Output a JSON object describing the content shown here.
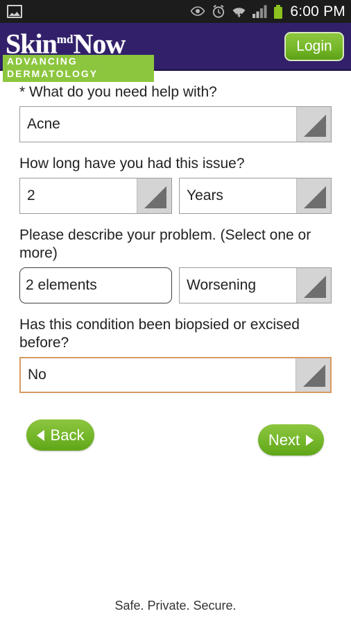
{
  "status_bar": {
    "notification_icon": "picture-icon",
    "icons": [
      "eye-icon",
      "alarm-clock-icon",
      "wifi-icon",
      "signal-bars-icon",
      "battery-icon"
    ],
    "time": "6:00 PM",
    "battery_color": "#8bc220"
  },
  "header": {
    "logo_main": "Skin",
    "logo_sup": "md",
    "logo_main2": "Now",
    "logo_tagline": "ADVANCING DERMATOLOGY",
    "login_label": "Login",
    "background_color": "#32206a",
    "accent_green": "#8cc63f"
  },
  "form": {
    "q1": {
      "label": "* What do you need help with?",
      "value": "Acne"
    },
    "q2": {
      "label": "How long have you had this issue?",
      "amount_value": "2",
      "unit_value": "Years"
    },
    "q3": {
      "label": "Please describe your problem. (Select one or more)",
      "multi_value": "2 elements",
      "trend_value": "Worsening"
    },
    "q4": {
      "label": "Has this condition been biopsied or excised before?",
      "value": "No",
      "focus_border_color": "#d89a62"
    }
  },
  "nav": {
    "back_label": "Back",
    "next_label": "Next"
  },
  "footer": {
    "text": "Safe. Private. Secure."
  }
}
